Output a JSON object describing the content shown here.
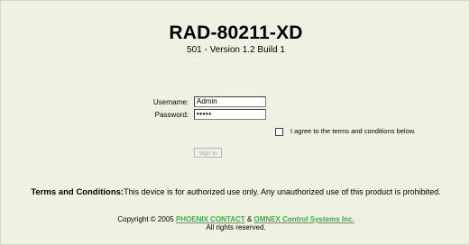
{
  "header": {
    "title": "RAD-80211-XD",
    "subtitle": "501 - Version 1.2 Build 1"
  },
  "login": {
    "username_label": "Username:",
    "username_value": "Admin",
    "password_label": "Password:",
    "password_value": "•••••",
    "agree_text": "I agree to the terms and conditions below.",
    "signin_label": "Sign In"
  },
  "terms": {
    "heading": "Terms and Conditions:",
    "text": "This device is for authorized use only. Any unauthorized use of this product is prohibited."
  },
  "footer": {
    "copyright_prefix": "Copyright © 2005",
    "link1": "PHOENIX CONTACT",
    "amp": "&",
    "link2": "OMNEX Control Systems Inc.",
    "rights": "All rights reserved."
  },
  "colors": {
    "background": "#eff1e3",
    "link": "#3cb043"
  }
}
